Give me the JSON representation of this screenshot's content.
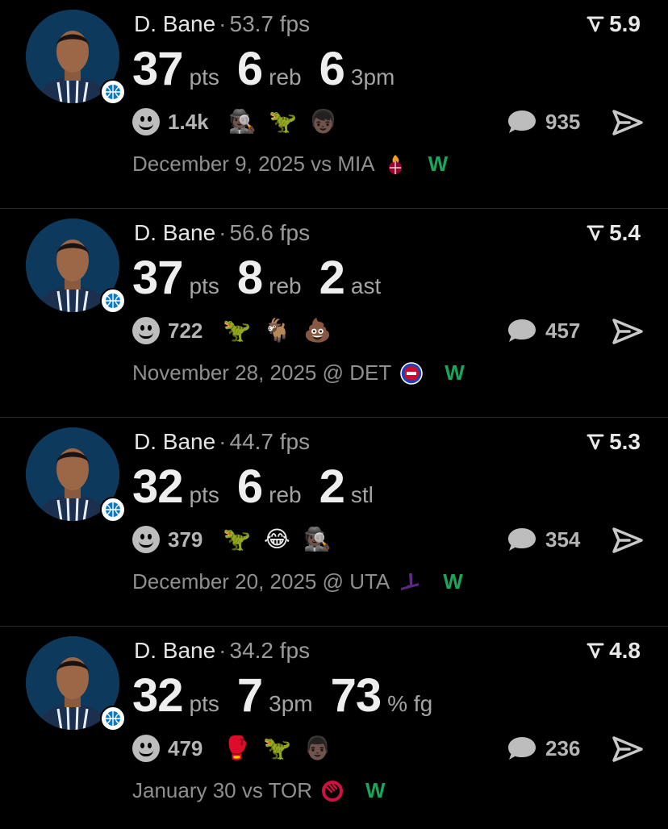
{
  "cards": [
    {
      "player": "D. Bane",
      "fps": "53.7 fps",
      "rating": "5.9",
      "stats": [
        {
          "value": "37",
          "label": "pts"
        },
        {
          "value": "6",
          "label": "reb"
        },
        {
          "value": "6",
          "label": "3pm"
        }
      ],
      "reaction_count": "1.4k",
      "reaction_emojis": [
        "🕵🏿",
        "🦖",
        "👦🏿"
      ],
      "comment_count": "935",
      "game": "December 9, 2025 vs MIA",
      "team_logo": "heat-logo-icon",
      "result": "W"
    },
    {
      "player": "D. Bane",
      "fps": "56.6 fps",
      "rating": "5.4",
      "stats": [
        {
          "value": "37",
          "label": "pts"
        },
        {
          "value": "8",
          "label": "reb"
        },
        {
          "value": "2",
          "label": "ast"
        }
      ],
      "reaction_count": "722",
      "reaction_emojis": [
        "🦖",
        "🐐",
        "💩"
      ],
      "comment_count": "457",
      "game": "November 28, 2025 @ DET",
      "team_logo": "pistons-logo-icon",
      "result": "W"
    },
    {
      "player": "D. Bane",
      "fps": "44.7 fps",
      "rating": "5.3",
      "stats": [
        {
          "value": "32",
          "label": "pts"
        },
        {
          "value": "6",
          "label": "reb"
        },
        {
          "value": "2",
          "label": "stl"
        }
      ],
      "reaction_count": "379",
      "reaction_emojis": [
        "🦖",
        "😂",
        "🕵🏿"
      ],
      "comment_count": "354",
      "game": "December 20, 2025 @ UTA",
      "team_logo": "jazz-logo-icon",
      "result": "W"
    },
    {
      "player": "D. Bane",
      "fps": "34.2 fps",
      "rating": "4.8",
      "stats": [
        {
          "value": "32",
          "label": "pts"
        },
        {
          "value": "7",
          "label": "3pm"
        },
        {
          "value": "73",
          "label": "% fg"
        }
      ],
      "reaction_count": "479",
      "reaction_emojis": [
        "🥊",
        "🦖",
        "👨🏿"
      ],
      "comment_count": "236",
      "game": "January 30 vs TOR",
      "team_logo": "raptors-logo-icon",
      "result": "W"
    }
  ],
  "colors": {
    "background": "#000000",
    "win": "#19a65a",
    "avatar_bg": "#0d3a5c"
  }
}
